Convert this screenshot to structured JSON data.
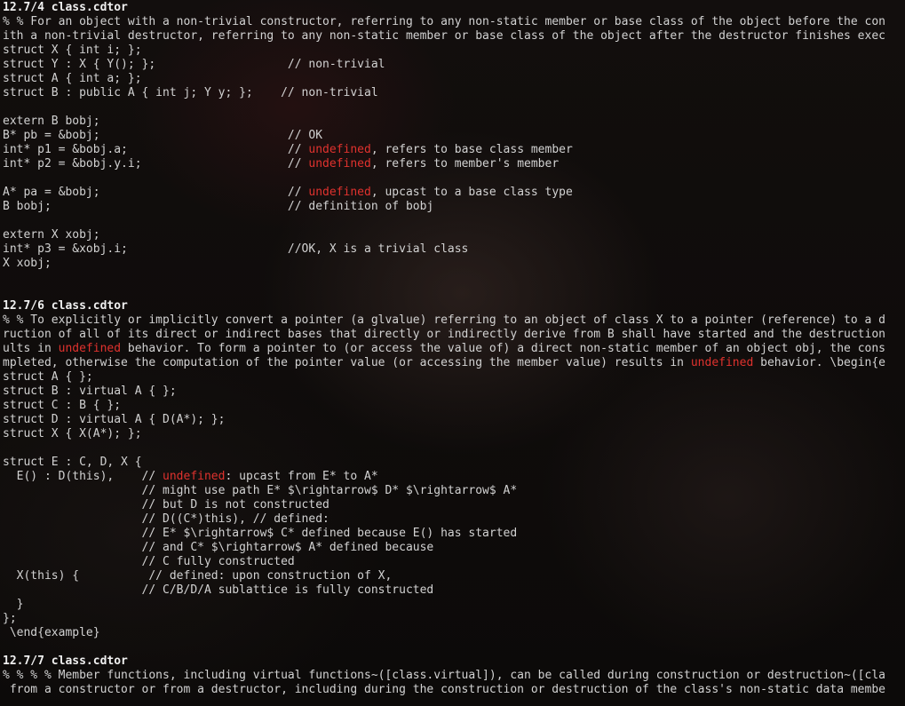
{
  "colors": {
    "text": "#d2d2d2",
    "heading": "#f0f0f0",
    "highlight": "#e0322e",
    "background": "#0f0c0b"
  },
  "lines": [
    {
      "head": true,
      "segments": [
        "12.7/4 class.cdtor"
      ]
    },
    {
      "segments": [
        "% % For an object with a non-trivial constructor, referring to any non-static member or base class of the object before the con"
      ]
    },
    {
      "segments": [
        "ith a non-trivial destructor, referring to any non-static member or base class of the object after the destructor finishes exec"
      ]
    },
    {
      "segments": [
        "struct X { int i; };"
      ]
    },
    {
      "segments": [
        "struct Y : X { Y(); };                   // non-trivial"
      ]
    },
    {
      "segments": [
        "struct A { int a; };"
      ]
    },
    {
      "segments": [
        "struct B : public A { int j; Y y; };    // non-trivial"
      ]
    },
    {
      "segments": [
        ""
      ]
    },
    {
      "segments": [
        "extern B bobj;"
      ]
    },
    {
      "segments": [
        "B* pb = &bobj;                           // OK"
      ]
    },
    {
      "segments": [
        "int* p1 = &bobj.a;                       // ",
        {
          "kw": "undefined"
        },
        ", refers to base class member"
      ]
    },
    {
      "segments": [
        "int* p2 = &bobj.y.i;                     // ",
        {
          "kw": "undefined"
        },
        ", refers to member's member"
      ]
    },
    {
      "segments": [
        ""
      ]
    },
    {
      "segments": [
        "A* pa = &bobj;                           // ",
        {
          "kw": "undefined"
        },
        ", upcast to a base class type"
      ]
    },
    {
      "segments": [
        "B bobj;                                  // definition of bobj"
      ]
    },
    {
      "segments": [
        ""
      ]
    },
    {
      "segments": [
        "extern X xobj;"
      ]
    },
    {
      "segments": [
        "int* p3 = &xobj.i;                       //OK, X is a trivial class"
      ]
    },
    {
      "segments": [
        "X xobj;"
      ]
    },
    {
      "segments": [
        ""
      ]
    },
    {
      "segments": [
        ""
      ]
    },
    {
      "head": true,
      "segments": [
        "12.7/6 class.cdtor"
      ]
    },
    {
      "segments": [
        "% % To explicitly or implicitly convert a pointer (a glvalue) referring to an object of class X to a pointer (reference) to a d"
      ]
    },
    {
      "segments": [
        "ruction of all of its direct or indirect bases that directly or indirectly derive from B shall have started and the destruction"
      ]
    },
    {
      "segments": [
        "ults in ",
        {
          "kw": "undefined"
        },
        " behavior. To form a pointer to (or access the value of) a direct non-static member of an object obj, the cons"
      ]
    },
    {
      "segments": [
        "mpleted, otherwise the computation of the pointer value (or accessing the member value) results in ",
        {
          "kw": "undefined"
        },
        " behavior. \\begin{e"
      ]
    },
    {
      "segments": [
        "struct A { };"
      ]
    },
    {
      "segments": [
        "struct B : virtual A { };"
      ]
    },
    {
      "segments": [
        "struct C : B { };"
      ]
    },
    {
      "segments": [
        "struct D : virtual A { D(A*); };"
      ]
    },
    {
      "segments": [
        "struct X { X(A*); };"
      ]
    },
    {
      "segments": [
        ""
      ]
    },
    {
      "segments": [
        "struct E : C, D, X {"
      ]
    },
    {
      "segments": [
        "  E() : D(this),    // ",
        {
          "kw": "undefined"
        },
        ": upcast from E* to A*"
      ]
    },
    {
      "segments": [
        "                    // might use path E* $\\rightarrow$ D* $\\rightarrow$ A*"
      ]
    },
    {
      "segments": [
        "                    // but D is not constructed"
      ]
    },
    {
      "segments": [
        "                    // D((C*)this), // defined:"
      ]
    },
    {
      "segments": [
        "                    // E* $\\rightarrow$ C* defined because E() has started"
      ]
    },
    {
      "segments": [
        "                    // and C* $\\rightarrow$ A* defined because"
      ]
    },
    {
      "segments": [
        "                    // C fully constructed"
      ]
    },
    {
      "segments": [
        "  X(this) {          // defined: upon construction of X,"
      ]
    },
    {
      "segments": [
        "                    // C/B/D/A sublattice is fully constructed"
      ]
    },
    {
      "segments": [
        "  }"
      ]
    },
    {
      "segments": [
        "};"
      ]
    },
    {
      "segments": [
        " \\end{example}"
      ]
    },
    {
      "segments": [
        ""
      ]
    },
    {
      "head": true,
      "segments": [
        "12.7/7 class.cdtor"
      ]
    },
    {
      "segments": [
        "% % % % Member functions, including virtual functions~([class.virtual]), can be called during construction or destruction~([cla"
      ]
    },
    {
      "segments": [
        " from a constructor or from a destructor, including during the construction or destruction of the class's non-static data membe"
      ]
    }
  ]
}
